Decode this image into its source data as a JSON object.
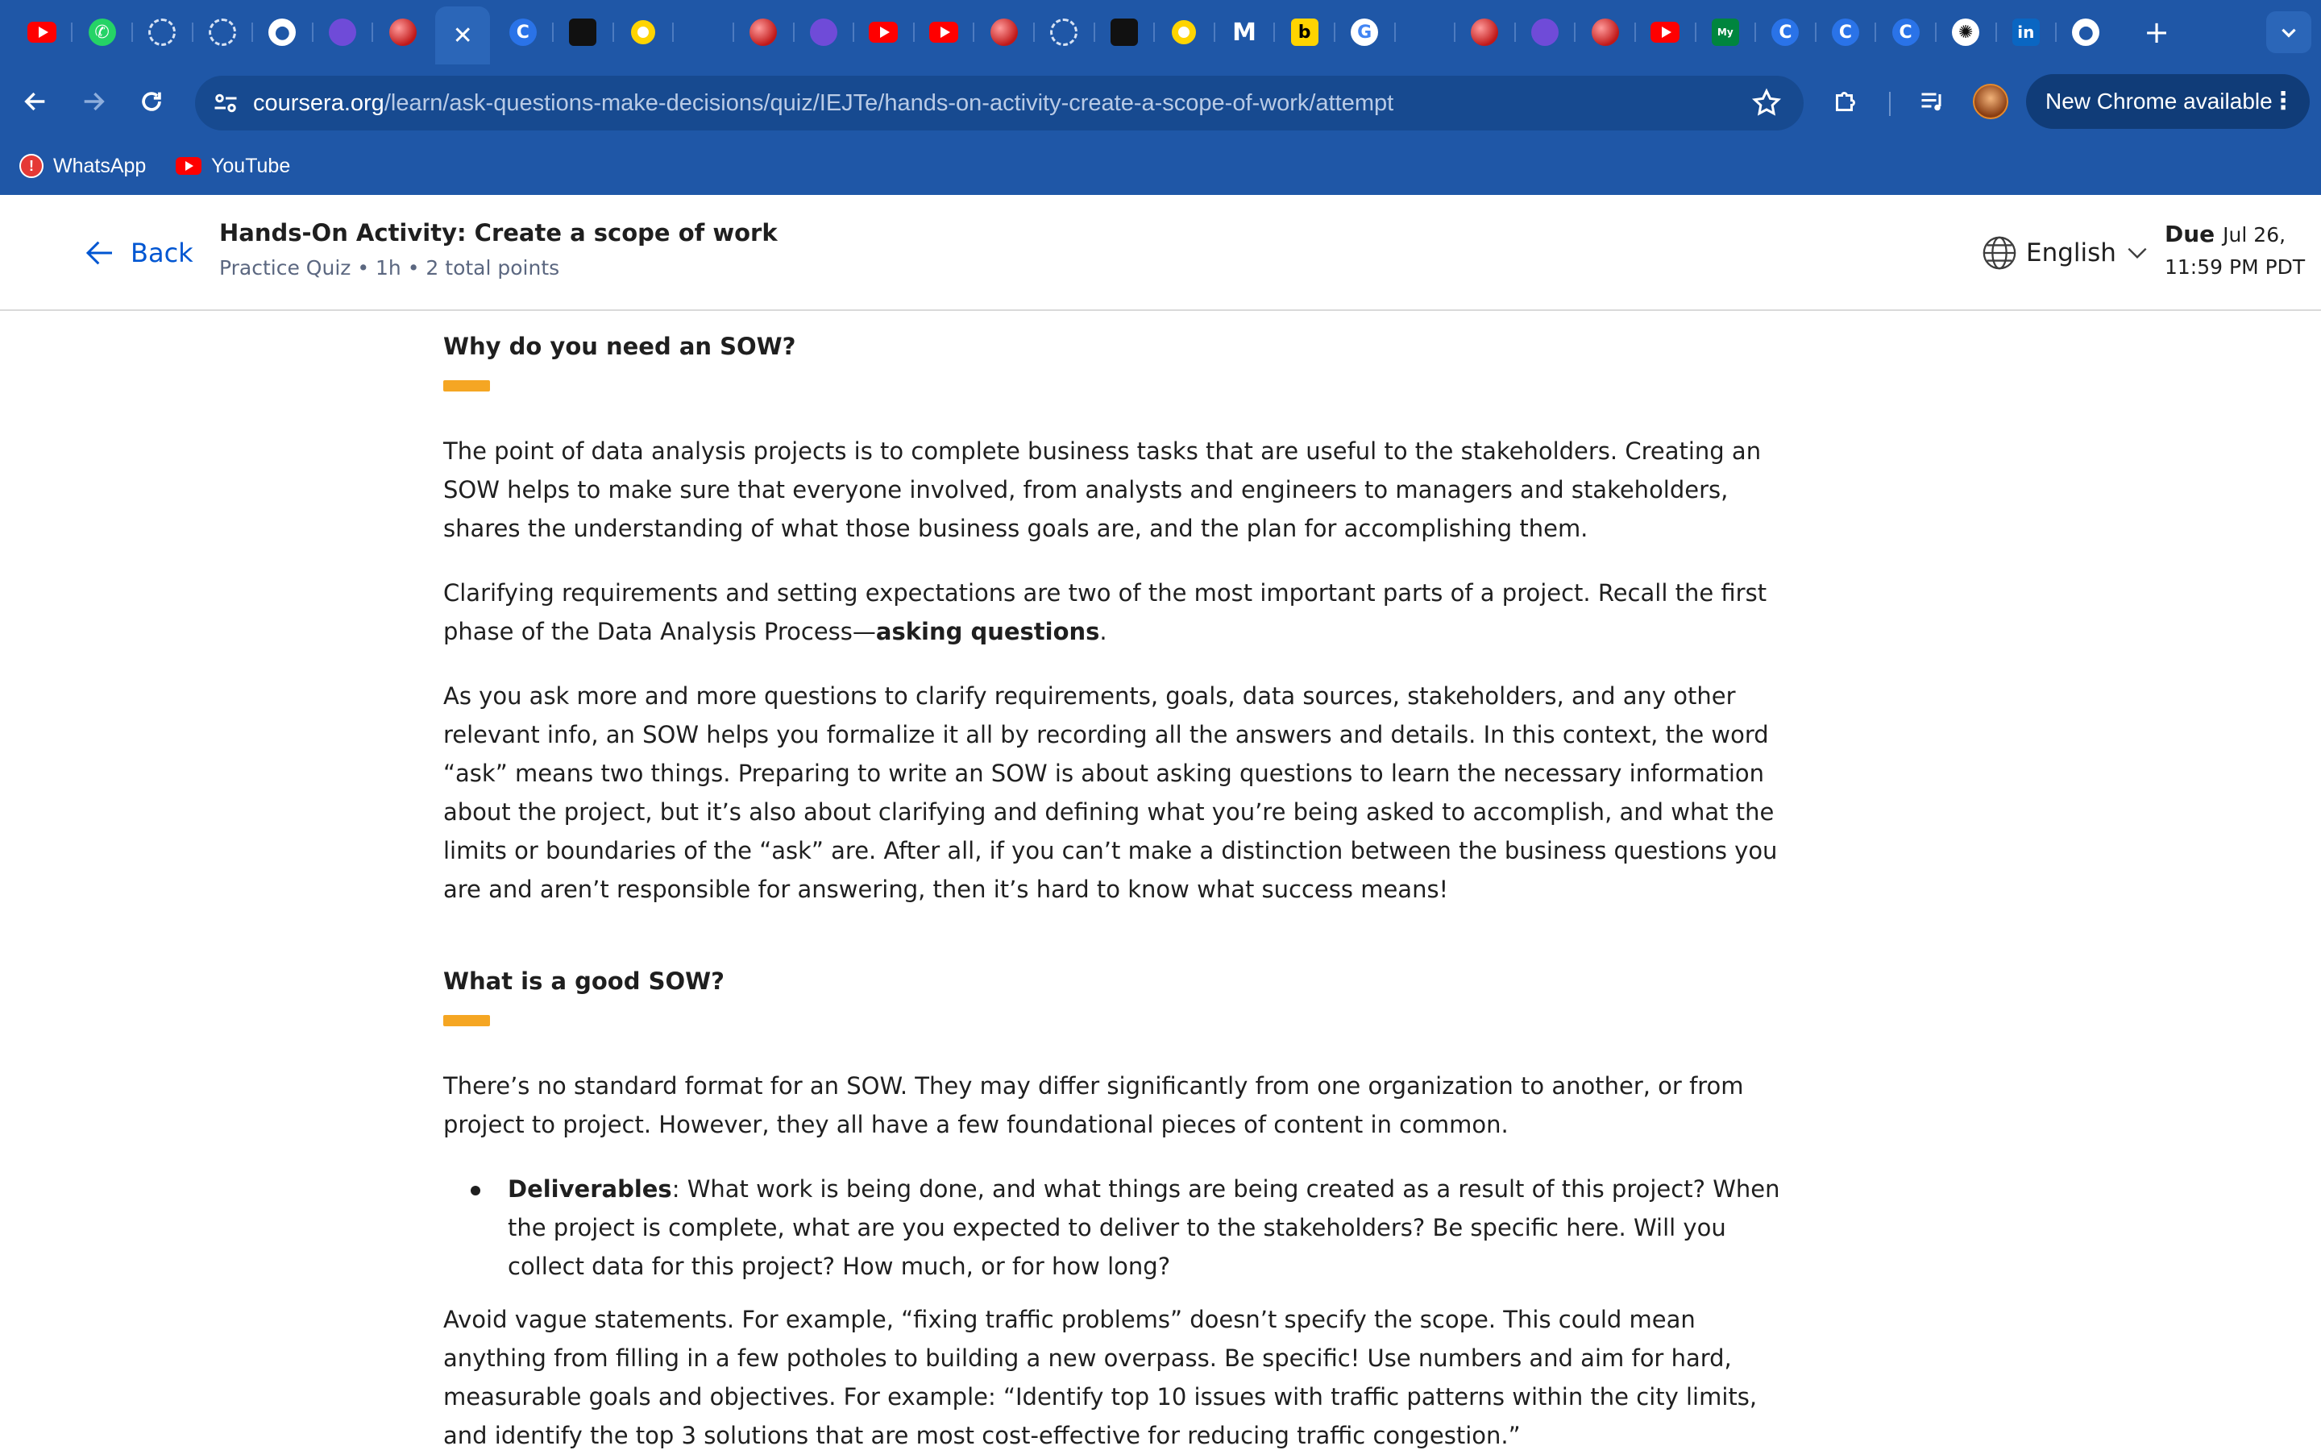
{
  "browser": {
    "tabs": [
      {
        "icon": "youtube-icon"
      },
      {
        "icon": "whatsapp-icon"
      },
      {
        "icon": "loading-icon"
      },
      {
        "icon": "loading-icon"
      },
      {
        "icon": "github-icon"
      },
      {
        "icon": "app-icon"
      },
      {
        "icon": "app-icon"
      },
      {
        "icon": "close-icon",
        "active": true
      },
      {
        "icon": "coursera-icon"
      },
      {
        "icon": "app-icon"
      },
      {
        "icon": "app-icon"
      },
      {
        "icon": "app-icon"
      },
      {
        "icon": "app-icon"
      },
      {
        "icon": "app-icon"
      },
      {
        "icon": "youtube-icon"
      },
      {
        "icon": "youtube-icon"
      },
      {
        "icon": "app-icon"
      },
      {
        "icon": "loading-icon"
      },
      {
        "icon": "app-icon"
      },
      {
        "icon": "app-icon"
      },
      {
        "icon": "m-icon"
      },
      {
        "icon": "b-icon"
      },
      {
        "icon": "google-icon"
      },
      {
        "icon": "app-icon"
      },
      {
        "icon": "app-icon"
      },
      {
        "icon": "app-icon"
      },
      {
        "icon": "app-icon"
      },
      {
        "icon": "youtube-icon"
      },
      {
        "icon": "myunt-icon"
      },
      {
        "icon": "coursera-icon"
      },
      {
        "icon": "coursera-icon"
      },
      {
        "icon": "coursera-icon"
      },
      {
        "icon": "chatgpt-icon"
      },
      {
        "icon": "linkedin-icon"
      },
      {
        "icon": "github-icon"
      }
    ],
    "url_host": "coursera.org",
    "url_path": "/learn/ask-questions-make-decisions/quiz/IEJTe/hands-on-activity-create-a-scope-of-work/attempt",
    "update_label": "New Chrome available",
    "bookmarks": [
      {
        "label": "WhatsApp",
        "icon": "whatsapp-icon"
      },
      {
        "label": "YouTube",
        "icon": "youtube-icon"
      }
    ],
    "colors": {
      "frame": "#1f57a7",
      "omnibox": "#174a90"
    }
  },
  "header": {
    "back_label": "Back",
    "title": "Hands-On Activity: Create a scope of work",
    "meta": "Practice Quiz • 1h • 2 total points",
    "language": "English",
    "due_label": "Due",
    "due_date": "Jul 26,",
    "due_time": "11:59 PM PDT"
  },
  "content": {
    "section1": {
      "heading": "Why do you need an SOW?",
      "p1": "The point of data analysis projects is to complete business tasks that are useful to the stakeholders. Creating an SOW helps to make sure that everyone involved, from analysts and engineers to managers and stakeholders, shares the understanding of what those business goals are, and the plan for accomplishing them.",
      "p2_before": "Clarifying requirements and setting expectations are two of the most important parts of a project. Recall the first phase of the Data Analysis Process—",
      "p2_bold": "asking questions",
      "p2_after": ".",
      "p3": "As you ask more and more questions to clarify requirements, goals, data sources, stakeholders, and any other relevant info, an SOW helps you formalize it all by recording all the answers and details. In this context, the word “ask” means two things. Preparing to write an SOW is about asking questions to learn the necessary information about the project, but it’s also about clarifying and defining what you’re being asked to accomplish, and what the limits or boundaries of the “ask” are. After all, if you can’t make a distinction between the business questions you are and aren’t responsible for answering, then it’s hard to know what success means!"
    },
    "section2": {
      "heading": "What is a good SOW?",
      "p1": "There’s no standard format for an SOW. They may differ significantly from one organization to another, or from project to project. However, they all have a few foundational pieces of content in common.",
      "bullet_bold": "Deliverables",
      "bullet_text": ": What work is being done, and what things are being created as a result of this project? When the project is complete, what are you expected to deliver to the stakeholders? Be specific here. Will you collect data for this project? How much, or for how long?",
      "p2": "Avoid vague statements. For example, “fixing traffic problems” doesn’t specify the scope. This could mean anything from filling in a few potholes to building a new overpass. Be specific! Use numbers and aim for hard, measurable goals and objectives. For example: “Identify top 10 issues with traffic patterns within the city limits, and identify the top 3 solutions that are most cost-effective for reducing traffic congestion.”"
    },
    "accent_color": "#f5a623"
  }
}
